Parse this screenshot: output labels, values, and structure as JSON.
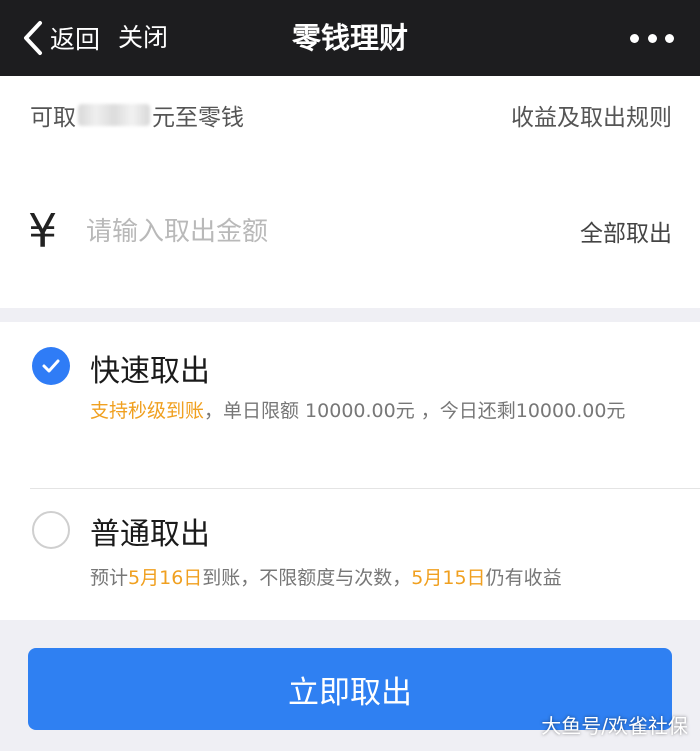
{
  "nav": {
    "back_label": "返回",
    "close_label": "关闭",
    "title": "零钱理财"
  },
  "amount": {
    "avail_prefix": "可取",
    "avail_suffix": "元至零钱",
    "rules_link": "收益及取出规则",
    "currency_symbol": "¥",
    "input_placeholder": "请输入取出金额",
    "input_value": "",
    "withdraw_all": "全部取出"
  },
  "options": {
    "fast": {
      "title": "快速取出",
      "checked": true,
      "desc_highlight": "支持秒级到账",
      "desc_rest": "，单日限额 10000.00元 ，今日还剩10000.00元"
    },
    "normal": {
      "title": "普通取出",
      "checked": false,
      "desc_part1": "预计",
      "desc_date1": "5月16日",
      "desc_part2": "到账，不限额度与次数，",
      "desc_date2": "5月15日",
      "desc_part3": "仍有收益"
    }
  },
  "submit_label": "立即取出",
  "watermark": "大鱼号/欢雀社保",
  "colors": {
    "accent": "#2f80f2",
    "highlight": "#f0a020",
    "navbar": "#1d1d1f"
  }
}
